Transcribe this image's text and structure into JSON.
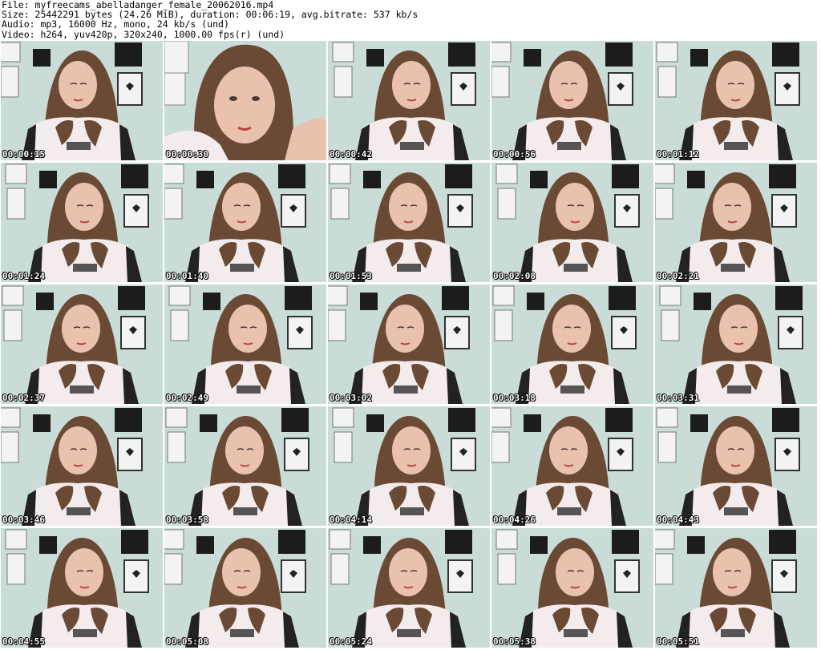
{
  "header": {
    "file": "File: myfreecams_abelladanger_female_20062016.mp4",
    "size": "Size: 25442291 bytes (24.26 MiB), duration: 00:06:19, avg.bitrate: 537 kb/s",
    "audio": "Audio: mp3, 16000 Hz, mono, 24 kb/s (und)",
    "video": "Video: h264, yuv420p, 320x240, 1000.00 fps(r) (und)"
  },
  "thumbnails": [
    {
      "time": "00:00:15"
    },
    {
      "time": "00:00:30"
    },
    {
      "time": "00:00:42"
    },
    {
      "time": "00:00:56"
    },
    {
      "time": "00:01:12"
    },
    {
      "time": "00:01:24"
    },
    {
      "time": "00:01:40"
    },
    {
      "time": "00:01:53"
    },
    {
      "time": "00:02:08"
    },
    {
      "time": "00:02:21"
    },
    {
      "time": "00:02:37"
    },
    {
      "time": "00:02:49"
    },
    {
      "time": "00:03:02"
    },
    {
      "time": "00:03:18"
    },
    {
      "time": "00:03:31"
    },
    {
      "time": "00:03:46"
    },
    {
      "time": "00:03:58"
    },
    {
      "time": "00:04:14"
    },
    {
      "time": "00:04:26"
    },
    {
      "time": "00:04:43"
    },
    {
      "time": "00:04:55"
    },
    {
      "time": "00:05:08"
    },
    {
      "time": "00:05:24"
    },
    {
      "time": "00:05:38"
    },
    {
      "time": "00:05:51"
    }
  ],
  "colors": {
    "wall": "#c9dcd7",
    "hair": "#6b4a35",
    "skin": "#e9c2ae",
    "shirt": "#f4ecec",
    "poster_dark": "#1c1c1c",
    "poster_light": "#f3f3f3"
  }
}
